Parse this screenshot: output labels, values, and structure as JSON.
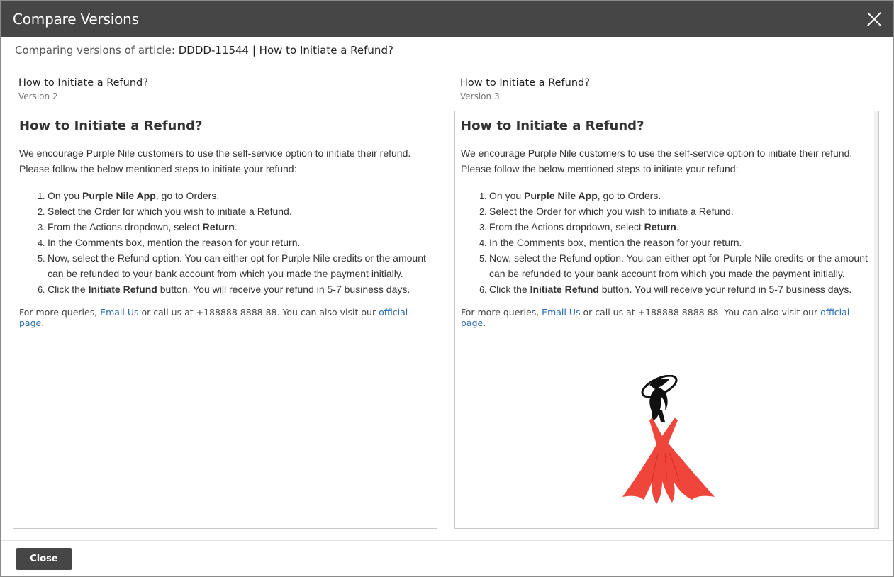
{
  "dialog": {
    "title": "Compare Versions",
    "subtitle_prefix": "Comparing versions of article:",
    "subtitle_value": "DDDD-11544 | How to Initiate a Refund?",
    "close_button": "Close"
  },
  "versions": [
    {
      "title": "How to Initiate a Refund?",
      "version": "Version 2",
      "heading": "How to Initiate a Refund?",
      "intro_1": "We encourage Purple Nile customers to use the self-service option to initiate their refund.",
      "intro_2": "Please follow the below mentioned steps to initiate your refund:",
      "steps": [
        {
          "pre": " On you ",
          "bold": "Purple Nile App",
          "post": ", go to Orders."
        },
        {
          "pre": "Select the Order for which you wish to initiate a Refund.",
          "bold": "",
          "post": ""
        },
        {
          "pre": "From the Actions dropdown, select ",
          "bold": "Return",
          "post": "."
        },
        {
          "pre": "In the Comments box, mention the reason for your return.",
          "bold": "",
          "post": ""
        },
        {
          "pre": "Now, select the Refund option. You can either opt for Purple Nile credits or the amount can be refunded to your bank account from which you made the payment initially.",
          "bold": "",
          "post": ""
        },
        {
          "pre": "Click the ",
          "bold": "Initiate Refund",
          "post": " button. You will receive your refund in 5-7 business days."
        }
      ],
      "footer_pre": "For more queries, ",
      "footer_link1": "Email Us",
      "footer_mid": " or call us at +188888 8888 88. You can also visit our ",
      "footer_link2": "official page",
      "footer_post": "."
    },
    {
      "title": "How to Initiate a Refund?",
      "version": "Version 3",
      "heading": "How to Initiate a Refund?",
      "intro_1": "We encourage Purple Nile customers to use the self-service option to initiate their refund.",
      "intro_2": "Please follow the below mentioned steps to initiate your refund:",
      "steps": [
        {
          "pre": " On you ",
          "bold": "Purple Nile App",
          "post": ", go to Orders."
        },
        {
          "pre": "Select the Order for which you wish to initiate a Refund.",
          "bold": "",
          "post": ""
        },
        {
          "pre": "From the Actions dropdown, select ",
          "bold": "Return",
          "post": "."
        },
        {
          "pre": "In the Comments box, mention the reason for your return.",
          "bold": "",
          "post": ""
        },
        {
          "pre": "Now, select the Refund option. You can either opt for Purple Nile credits or the amount can be refunded to your bank account from which you made the payment initially.",
          "bold": "",
          "post": ""
        },
        {
          "pre": "Click the ",
          "bold": "Initiate Refund",
          "post": " button. You will receive your refund in 5-7 business days."
        }
      ],
      "footer_pre": "For more queries, ",
      "footer_link1": "Email Us",
      "footer_mid": " or call us at +188888 8888 88. You can also visit our ",
      "footer_link2": "official page",
      "footer_post": ".",
      "image": "woman-in-red-dress-illustration"
    }
  ],
  "colors": {
    "titlebar": "#464646",
    "link": "#2a6aad",
    "dress": "#f0453a"
  }
}
